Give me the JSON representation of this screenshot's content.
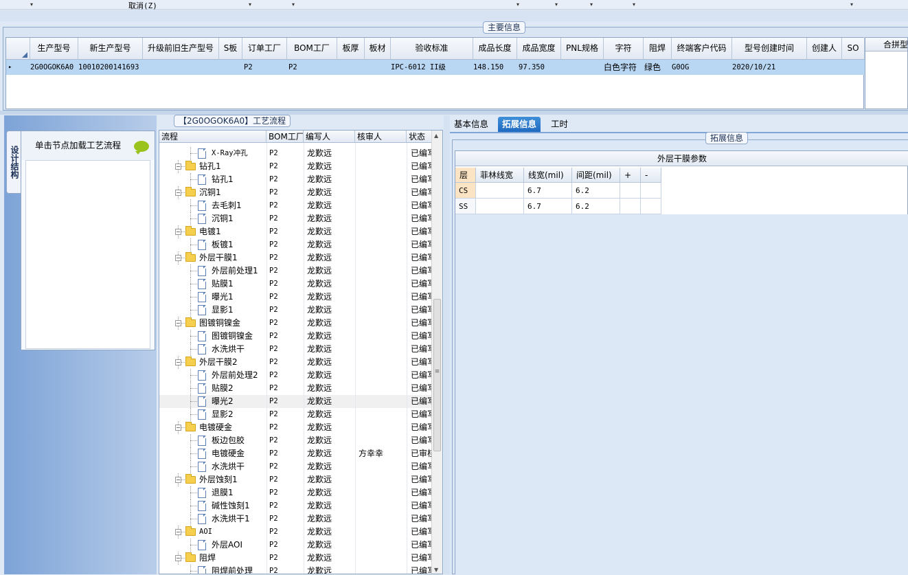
{
  "toolbar": {
    "cancel_label": "取消(Z)",
    "dropdown_glyph": "▾"
  },
  "main_info": {
    "group_title": "主要信息",
    "columns": [
      "生产型号",
      "新生产型号",
      "升级前旧生产型号",
      "S板",
      "订单工厂",
      "BOM工厂",
      "板厚",
      "板材",
      "验收标准",
      "成品长度",
      "成品宽度",
      "PNL规格",
      "字符",
      "阻焊",
      "终端客户代码",
      "型号创建时间",
      "创建人",
      "SO"
    ],
    "row": {
      "indicator": "▸",
      "生产型号": "2G0OGOK6A0",
      "新生产型号": "10010200141693",
      "升级前旧生产型号": "",
      "S板": "",
      "订单工厂": "P2",
      "BOM工厂": "P2",
      "板厚": "",
      "板材": "",
      "验收标准": "IPC-6012 II级",
      "成品长度": "148.150",
      "成品宽度": "97.350",
      "PNL规格": "",
      "字符": "白色字符",
      "阻焊": "绿色",
      "终端客户代码": "G0OG",
      "型号创建时间": "2020/10/21",
      "创建人": "",
      "SO": ""
    },
    "merge_panel_label": "合拼型"
  },
  "left_panel": {
    "vertical_tab": "设计结构",
    "node_prompt": "单击节点加载工艺流程",
    "speech_icon": "speech-bubble-icon"
  },
  "process_tree": {
    "title": "【2G0OGOK6A0】工艺流程",
    "columns": [
      "流程",
      "BOM工厂",
      "编写人",
      "核审人",
      "状态"
    ],
    "rows": [
      {
        "kind": "child",
        "name": "X-Ray冲孔",
        "factory": "P2",
        "writer": "龙歎远",
        "reviewer": "",
        "status": "已编写"
      },
      {
        "kind": "group",
        "name": "钻孔1",
        "factory": "P2",
        "writer": "龙歎远",
        "reviewer": "",
        "status": "已编写"
      },
      {
        "kind": "child",
        "name": "钻孔1",
        "factory": "P2",
        "writer": "龙歎远",
        "reviewer": "",
        "status": "已编写"
      },
      {
        "kind": "group",
        "name": "沉铜1",
        "factory": "P2",
        "writer": "龙歎远",
        "reviewer": "",
        "status": "已编写"
      },
      {
        "kind": "child",
        "name": "去毛刺1",
        "factory": "P2",
        "writer": "龙歎远",
        "reviewer": "",
        "status": "已编写"
      },
      {
        "kind": "child",
        "name": "沉铜1",
        "factory": "P2",
        "writer": "龙歎远",
        "reviewer": "",
        "status": "已编写"
      },
      {
        "kind": "group",
        "name": "电镀1",
        "factory": "P2",
        "writer": "龙歎远",
        "reviewer": "",
        "status": "已编写"
      },
      {
        "kind": "child",
        "name": "板镀1",
        "factory": "P2",
        "writer": "龙歎远",
        "reviewer": "",
        "status": "已编写"
      },
      {
        "kind": "group",
        "name": "外层干膜1",
        "factory": "P2",
        "writer": "龙歎远",
        "reviewer": "",
        "status": "已编写"
      },
      {
        "kind": "child",
        "name": "外层前处理1",
        "factory": "P2",
        "writer": "龙歎远",
        "reviewer": "",
        "status": "已编写"
      },
      {
        "kind": "child",
        "name": "贴膜1",
        "factory": "P2",
        "writer": "龙歎远",
        "reviewer": "",
        "status": "已编写"
      },
      {
        "kind": "child",
        "name": "曝光1",
        "factory": "P2",
        "writer": "龙歎远",
        "reviewer": "",
        "status": "已编写"
      },
      {
        "kind": "child",
        "name": "显影1",
        "factory": "P2",
        "writer": "龙歎远",
        "reviewer": "",
        "status": "已编写"
      },
      {
        "kind": "group",
        "name": "图镀铜镍金",
        "factory": "P2",
        "writer": "龙歎远",
        "reviewer": "",
        "status": "已编写"
      },
      {
        "kind": "child",
        "name": "图镀铜镍金",
        "factory": "P2",
        "writer": "龙歎远",
        "reviewer": "",
        "status": "已编写"
      },
      {
        "kind": "child",
        "name": "水洗烘干",
        "factory": "P2",
        "writer": "龙歎远",
        "reviewer": "",
        "status": "已编写"
      },
      {
        "kind": "group",
        "name": "外层干膜2",
        "factory": "P2",
        "writer": "龙歎远",
        "reviewer": "",
        "status": "已编写"
      },
      {
        "kind": "child",
        "name": "外层前处理2",
        "factory": "P2",
        "writer": "龙歎远",
        "reviewer": "",
        "status": "已编写"
      },
      {
        "kind": "child",
        "name": "贴膜2",
        "factory": "P2",
        "writer": "龙歎远",
        "reviewer": "",
        "status": "已编写"
      },
      {
        "kind": "child",
        "name": "曝光2",
        "factory": "P2",
        "writer": "龙歎远",
        "reviewer": "",
        "status": "已编写",
        "selected": true
      },
      {
        "kind": "child",
        "name": "显影2",
        "factory": "P2",
        "writer": "龙歎远",
        "reviewer": "",
        "status": "已编写"
      },
      {
        "kind": "group",
        "name": "电镀硬金",
        "factory": "P2",
        "writer": "龙歎远",
        "reviewer": "",
        "status": "已编写"
      },
      {
        "kind": "child",
        "name": "板边包胶",
        "factory": "P2",
        "writer": "龙歎远",
        "reviewer": "",
        "status": "已编写"
      },
      {
        "kind": "child",
        "name": "电镀硬金",
        "factory": "P2",
        "writer": "龙歎远",
        "reviewer": "方幸幸",
        "status": "已审核"
      },
      {
        "kind": "child",
        "name": "水洗烘干",
        "factory": "P2",
        "writer": "龙歎远",
        "reviewer": "",
        "status": "已编写"
      },
      {
        "kind": "group",
        "name": "外层蚀刻1",
        "factory": "P2",
        "writer": "龙歎远",
        "reviewer": "",
        "status": "已编写"
      },
      {
        "kind": "child",
        "name": "退膜1",
        "factory": "P2",
        "writer": "龙歎远",
        "reviewer": "",
        "status": "已编写"
      },
      {
        "kind": "child",
        "name": "碱性蚀刻1",
        "factory": "P2",
        "writer": "龙歎远",
        "reviewer": "",
        "status": "已编写"
      },
      {
        "kind": "child",
        "name": "水洗烘干1",
        "factory": "P2",
        "writer": "龙歎远",
        "reviewer": "",
        "status": "已编写"
      },
      {
        "kind": "group",
        "name": "AOI",
        "factory": "P2",
        "writer": "龙歎远",
        "reviewer": "",
        "status": "已编写"
      },
      {
        "kind": "child",
        "name": "外层AOI",
        "factory": "P2",
        "writer": "龙歎远",
        "reviewer": "",
        "status": "已编写"
      },
      {
        "kind": "group",
        "name": "阻焊",
        "factory": "P2",
        "writer": "龙歎远",
        "reviewer": "",
        "status": "已编写"
      },
      {
        "kind": "child",
        "name": "阻焊前处理",
        "factory": "P2",
        "writer": "龙歎远",
        "reviewer": "",
        "status": "已编写"
      }
    ]
  },
  "right_tabs": [
    "基本信息",
    "拓展信息",
    "工时"
  ],
  "active_tab": "拓展信息",
  "extended_info": {
    "group_title": "拓展信息",
    "caption": "外层干膜参数",
    "columns": [
      "层",
      "菲林线宽",
      "线宽(mil)",
      "间距(mil)",
      "+",
      "-"
    ],
    "rows": [
      {
        "层": "CS",
        "菲林线宽": "",
        "线宽(mil)": "6.7",
        "间距(mil)": "6.2",
        "+": "",
        "-": "",
        "highlight": true
      },
      {
        "层": "SS",
        "菲林线宽": "",
        "线宽(mil)": "6.7",
        "间距(mil)": "6.2",
        "+": "",
        "-": "",
        "highlight": false
      }
    ]
  },
  "colors": {
    "selected_row": "#b9d6f2",
    "active_tab": "#1f6ac0",
    "folder": "#f7cf4e",
    "speech_bubble": "#9bc31d"
  }
}
